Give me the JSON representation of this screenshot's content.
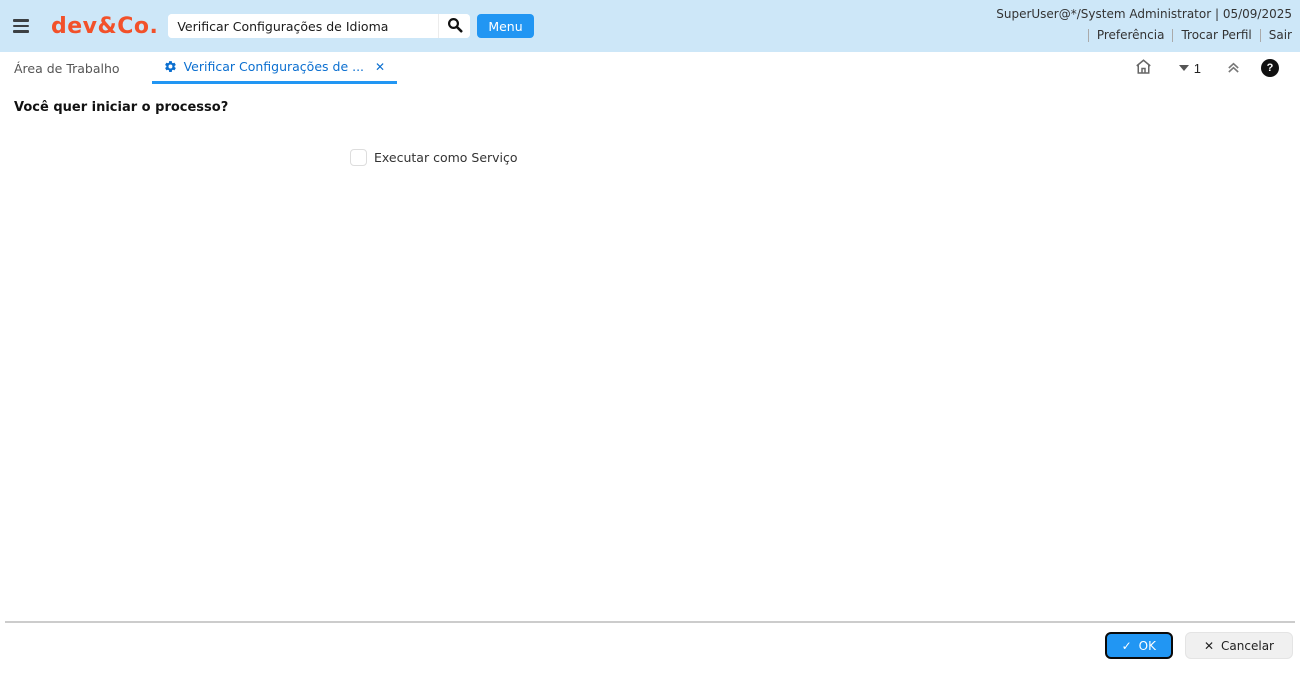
{
  "topbar": {
    "logo": "dev&Co.",
    "search": {
      "value": "Verificar Configurações de Idioma"
    },
    "menu_button": "Menu",
    "user_info": "SuperUser@*/System Administrator | 05/09/2025",
    "links": {
      "preference": "Preferência",
      "change_role": "Trocar Perfil",
      "logout": "Sair"
    }
  },
  "tabs": {
    "items": [
      {
        "label": "Área de Trabalho",
        "active": false
      },
      {
        "label": "Verificar Configurações de ...",
        "active": true
      }
    ],
    "window_count": "1"
  },
  "content": {
    "question": "Você quer iniciar o processo?",
    "checkbox_label": "Executar como Serviço",
    "checkbox_checked": false
  },
  "footer": {
    "ok_label": "OK",
    "cancel_label": "Cancelar"
  },
  "icons": {
    "check": "✓",
    "cancel_x": "✕",
    "tab_close": "✕",
    "help": "?"
  },
  "colors": {
    "topbar_bg": "#cde7f8",
    "accent_blue": "#2196f3",
    "active_tab_blue": "#0b6fd0",
    "logo_orange": "#f2512a",
    "ok_focus_border": "#0a0a0a"
  }
}
